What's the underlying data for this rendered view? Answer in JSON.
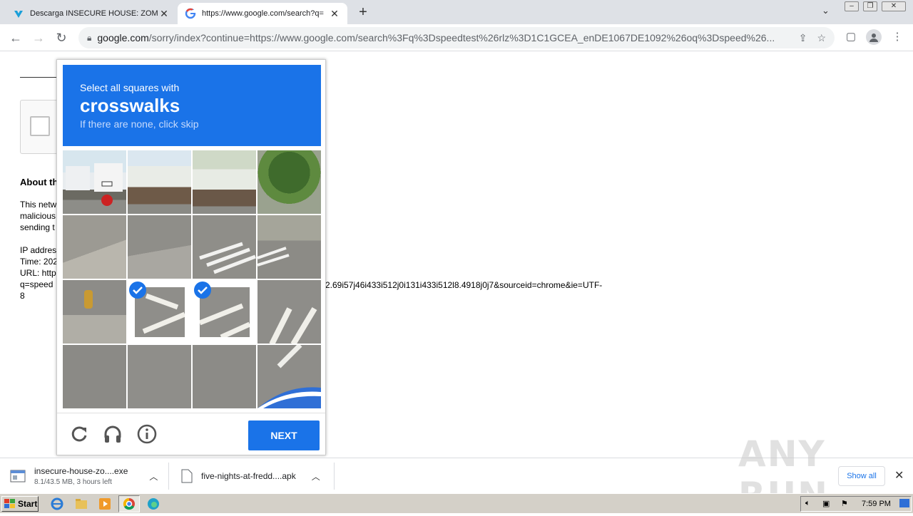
{
  "browser": {
    "tabs": [
      {
        "title": "Descarga INSECURE HOUSE: ZOMBIE",
        "active": false
      },
      {
        "title": "https://www.google.com/search?q=",
        "active": true
      }
    ],
    "new_tab_label": "+",
    "address": {
      "host": "google.com",
      "path": "/sorry/index?continue=https://www.google.com/search%3Fq%3Dspeedtest%26rlz%3D1C1GCEA_enDE1067DE1092%26oq%3Dspeed%26..."
    }
  },
  "page": {
    "about_heading": "About th",
    "para_lines": [
      "This netw",
      "malicious",
      "sending t"
    ],
    "info_lines": [
      "IP addres",
      "Time: 202",
      "URL: http",
      "q=speed",
      "8"
    ],
    "url_continuation": "2.69i57j46i433i512j0i131i433i512l8.4918j0j7&sourceid=chrome&ie=UTF-"
  },
  "captcha": {
    "instruction": "Select all squares with",
    "target": "crosswalks",
    "hint": "If there are none, click skip",
    "selected_tiles": [
      9,
      10
    ],
    "next_label": "NEXT",
    "colors": {
      "accent": "#1a73e8"
    }
  },
  "downloads": {
    "items": [
      {
        "name": "insecure-house-zo....exe",
        "status": "8.1/43.5 MB, 3 hours left"
      },
      {
        "name": "five-nights-at-fredd....apk",
        "status": ""
      }
    ],
    "show_all_label": "Show all"
  },
  "watermark": "ANY RUN",
  "taskbar": {
    "start_label": "Start",
    "clock": "7:59 PM"
  }
}
